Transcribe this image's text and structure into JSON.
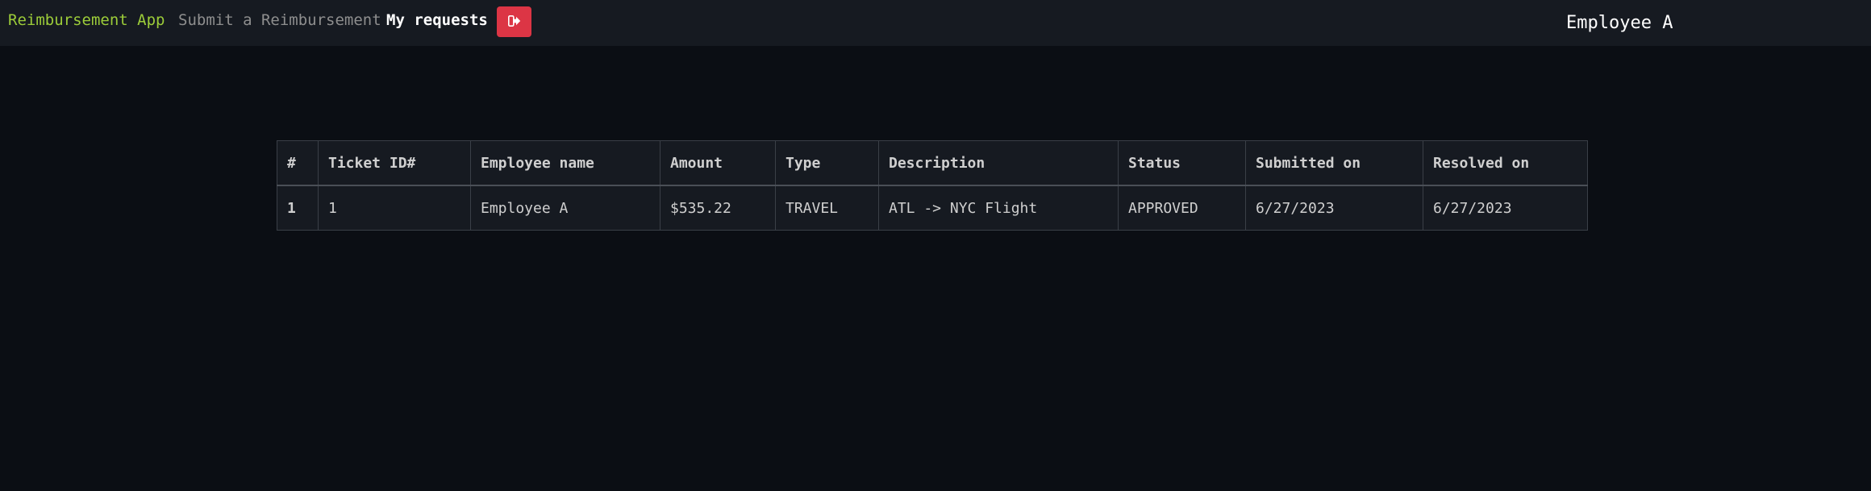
{
  "navbar": {
    "brand": "Reimbursement App",
    "submit_link": "Submit a Reimbursement",
    "requests_link": "My requests",
    "logout_icon": "sign-out-icon",
    "user_name": "Employee A"
  },
  "colors": {
    "brand": "#9ccc39",
    "logout_button": "#dc3545",
    "background": "#0b0e14",
    "navbar": "#161a21"
  },
  "table": {
    "columns": [
      "#",
      "Ticket ID#",
      "Employee name",
      "Amount",
      "Type",
      "Description",
      "Status",
      "Submitted on",
      "Resolved on"
    ],
    "rows": [
      [
        "1",
        "1",
        "Employee A",
        "$535.22",
        "TRAVEL",
        "ATL -> NYC Flight",
        "APPROVED",
        "6/27/2023",
        "6/27/2023"
      ]
    ]
  }
}
